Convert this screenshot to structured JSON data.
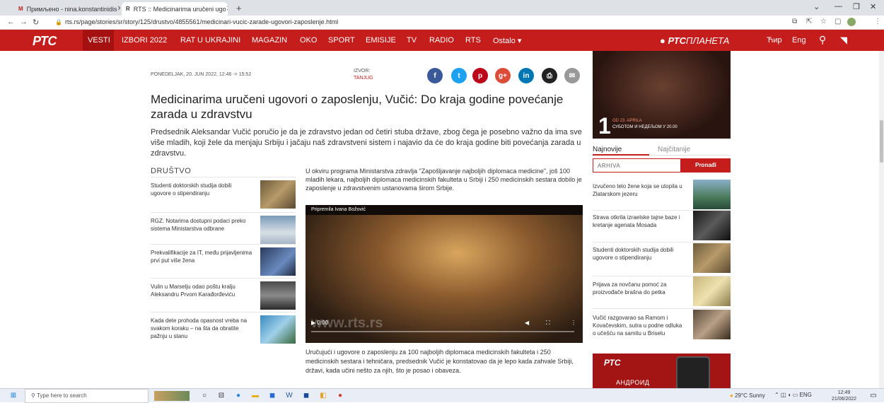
{
  "browser": {
    "tabs": [
      {
        "title": "Примљено - nina.konstantinidis",
        "active": false
      },
      {
        "title": "RTS :: Medicinarima uručeni ugo",
        "active": true
      }
    ],
    "url": "rts.rs/page/stories/sr/story/125/drustvo/4855561/medicinari-vucic-zarade-ugovori-zaposlenje.html"
  },
  "site": {
    "logo": "РТС",
    "nav": [
      "VESTI",
      "IZBORI 2022",
      "RAT U UKRAJINI",
      "MAGAZIN",
      "OKO",
      "SPORT",
      "EMISIJE",
      "TV",
      "RADIO",
      "RTS",
      "Ostalo"
    ],
    "planeta_bold": "РТС",
    "planeta_rest": "ПЛАНЕТА",
    "lang_cyr": "Ћир",
    "lang_eng": "Eng"
  },
  "article": {
    "date": "PONEDELJAK, 20. JUN 2022, 12:46 -> 15:52",
    "izvor_label": "IZVOR:",
    "izvor_value": "TANJUG",
    "headline": "Medicinarima uručeni ugovori o zaposlenju, Vučić: Do kraja godine povećanje zarada u zdravstvu",
    "lead": "Predsednik Aleksandar Vučić poručio je da je zdravstvo jedan od četiri stuba države, zbog čega je posebno važno da ima sve više mladih, koji žele da menjaju Srbiju i jačaju naš zdravstveni sistem i najavio da će do kraja godine biti povećanja zarada u zdravstvu.",
    "body1": "U okviru programa Ministarstva zdravlja \"Zapošljavanje najboljih diplomaca medicine\", još 100 mladih lekara, najboljih diplomaca medicinskih fakulteta u Srbiji i 250 medicinskih sestara dobilo je zaposlenje u zdravstvenim ustanovama širom Srbije.",
    "video_credit": "Pripremila Ivana Božović",
    "video_watermark": "www.rts.rs",
    "video_time": "0:00",
    "body2": "Uručujući i ugovore o zaposlenju za 100 najboljih diplomaca medicinskih fakulteta i 250 medicinskih sestara i tehničara, predsednik Vučić je konstatovao da je lepo kada zahvale Srbiji, državi, kada učini nešto za njih, što je posao i obaveza."
  },
  "related": {
    "section": "DRUŠTVO",
    "items": [
      {
        "text": "Studenti doktorskih studija dobili ugovore o stipendiranju"
      },
      {
        "text": "RGZ: Notarima dostupni podaci preko sistema Ministarstva odbrane"
      },
      {
        "text": "Prekvalifikacije za IT, među prijavljenima prvi put više žena"
      },
      {
        "text": "Vulin u Marselju odao poštu kralju Aleksandru Prvom Karađorđeviću"
      },
      {
        "text": "Kada dete prohoda opasnost vreba na svakom koraku – na šta da obratite pažnju u stanu"
      }
    ]
  },
  "sidebar": {
    "promo_date": "OD 23. APRILA",
    "promo_sub": "СУБОТОМ И НЕДЕЉОМ У 20.00",
    "promo_num": "1",
    "tab_latest": "Najnovije",
    "tab_read": "Najčitanije",
    "archive_placeholder": "ARHIVA",
    "search_button": "Pronađi",
    "items": [
      {
        "text": "Izvučeno telo žene koja se utopila u Zlatarskom jezeru"
      },
      {
        "text": "Strava otkrila izraelske tajne baze i kretanje agenata Mosada"
      },
      {
        "text": "Studenti doktorskih studija dobili ugovore o stipendiranju"
      },
      {
        "text": "Prijava za novčanu pomoć za proizvođače brašna do petka"
      },
      {
        "text": "Vučić razgovarao sa Ramom i Kovačevskim, sutra u podne odluka o učešću na samitu u Briselu"
      }
    ],
    "app_ad_logo": "РТС",
    "app_ad_text": "АНДРОИД"
  },
  "taskbar": {
    "search_placeholder": "Type here to search",
    "weather": "29°C  Sunny",
    "tray": "ENG",
    "time": "12:49",
    "date": "21/06/2022"
  },
  "colors": {
    "brand": "#c51c1c"
  }
}
